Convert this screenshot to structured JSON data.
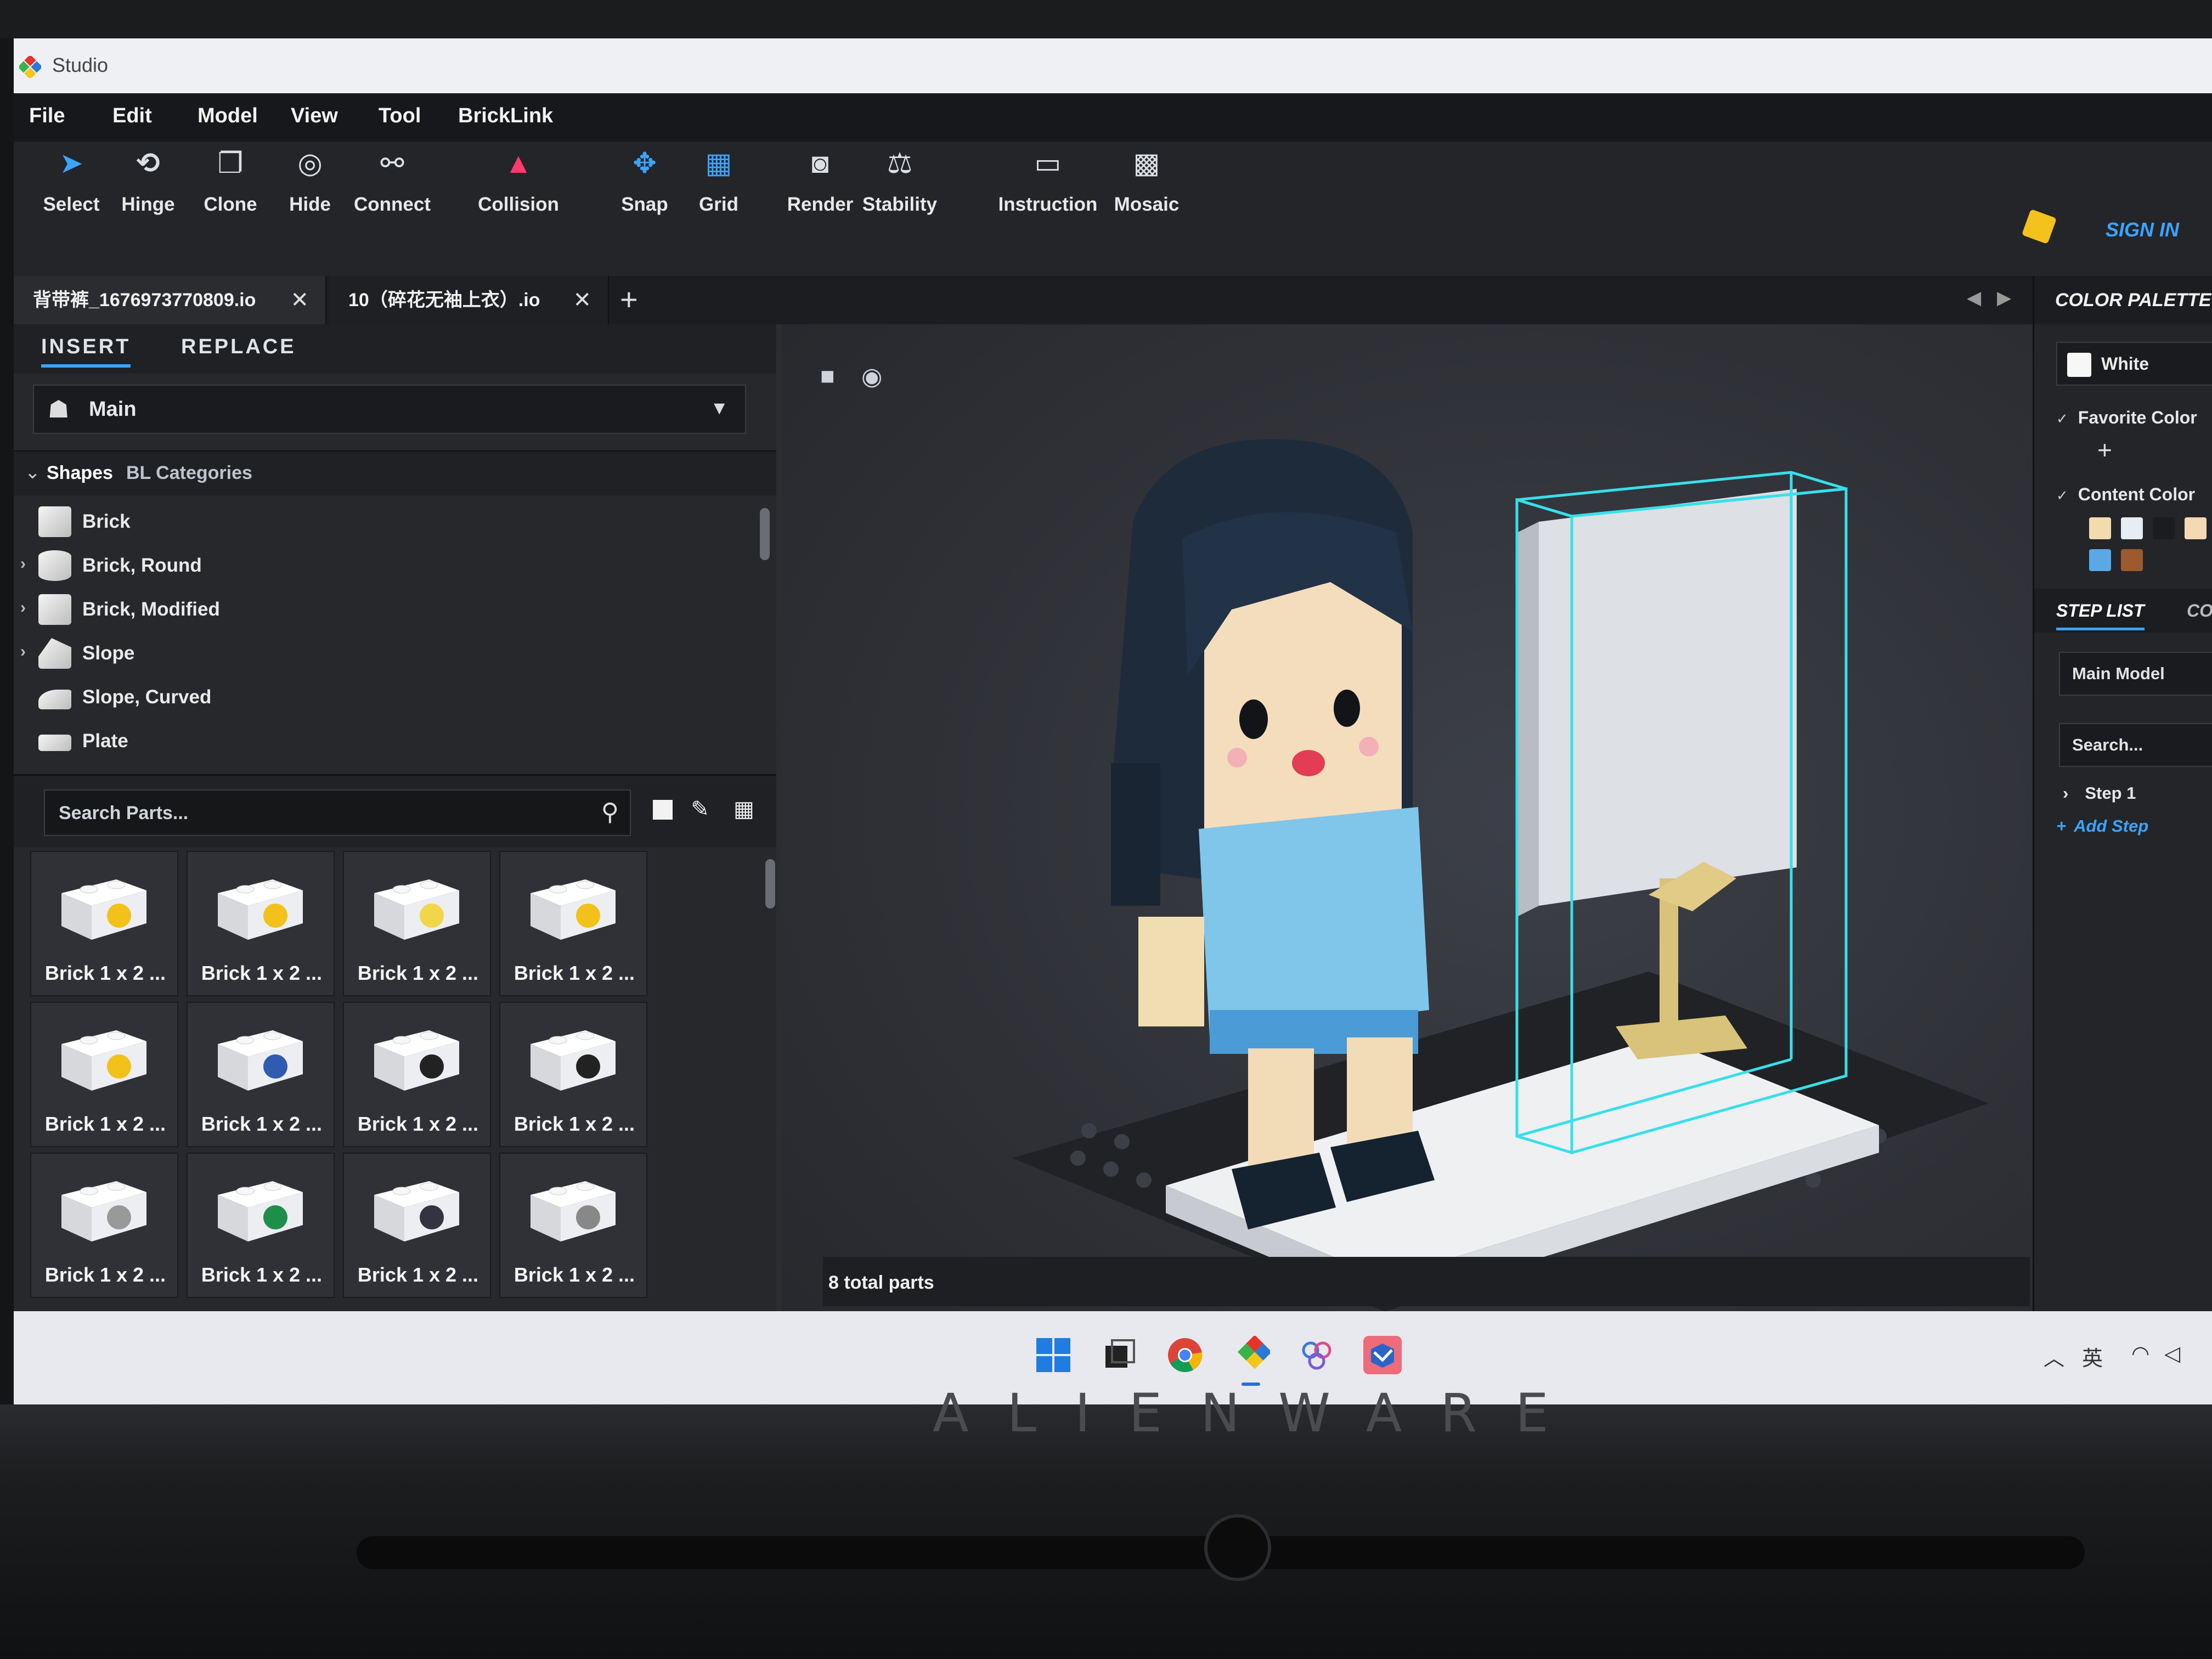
{
  "window": {
    "title": "Studio"
  },
  "menu": [
    "File",
    "Edit",
    "Model",
    "View",
    "Tool",
    "BrickLink"
  ],
  "toolbar": {
    "tools": [
      {
        "label": "Select",
        "icon": "cursor-icon"
      },
      {
        "label": "Hinge",
        "icon": "hinge-icon"
      },
      {
        "label": "Clone",
        "icon": "clone-icon"
      },
      {
        "label": "Hide",
        "icon": "hide-icon"
      },
      {
        "label": "Connect",
        "icon": "connect-icon"
      },
      {
        "label": "Collision",
        "icon": "collision-icon"
      },
      {
        "label": "Snap",
        "icon": "snap-icon"
      },
      {
        "label": "Grid",
        "icon": "grid-icon"
      },
      {
        "label": "Render",
        "icon": "render-icon"
      },
      {
        "label": "Stability",
        "icon": "stability-icon"
      },
      {
        "label": "Instruction",
        "icon": "instruction-icon"
      },
      {
        "label": "Mosaic",
        "icon": "mosaic-icon"
      }
    ],
    "sign_in": "SIGN IN"
  },
  "tabs": [
    {
      "label": "背带裤_1676973770809.io"
    },
    {
      "label": "10（碎花无袖上衣）.io"
    }
  ],
  "left_panel": {
    "tabs": [
      "INSERT",
      "REPLACE"
    ],
    "palette_select": "Main",
    "category_tabs": [
      "Shapes",
      "BL Categories"
    ],
    "categories": [
      "Brick",
      "Brick, Round",
      "Brick, Modified",
      "Slope",
      "Slope, Curved",
      "Plate"
    ],
    "search_placeholder": "Search Parts...",
    "parts": [
      "Brick 1 x 2 ...",
      "Brick 1 x 2 ...",
      "Brick 1 x 2 ...",
      "Brick 1 x 2 ...",
      "Brick 1 x 2 ...",
      "Brick 1 x 2 ...",
      "Brick 1 x 2 ...",
      "Brick 1 x 2 ...",
      "Brick 1 x 2 ...",
      "Brick 1 x 2 ...",
      "Brick 1 x 2 ...",
      "Brick 1 x 2 ..."
    ]
  },
  "viewport": {
    "status": "8 total parts"
  },
  "right_panel": {
    "header": "COLOR PALETTE",
    "current_color": "White",
    "favorite_colors": "Favorite Color",
    "content_colors": "Content Color",
    "swatches": [
      "#f2dcae",
      "#e6edf3",
      "#1a1c1f",
      "#f5d9b5",
      "#5aa9e6",
      "#9c5a2e"
    ],
    "tabs": [
      "STEP LIST",
      "COL"
    ],
    "model_select": "Main Model",
    "search_placeholder": "Search...",
    "step": "Step 1",
    "add_step": "Add Step"
  },
  "taskbar": {
    "ime": "英"
  },
  "device": {
    "brand": "ALIENWARE"
  }
}
